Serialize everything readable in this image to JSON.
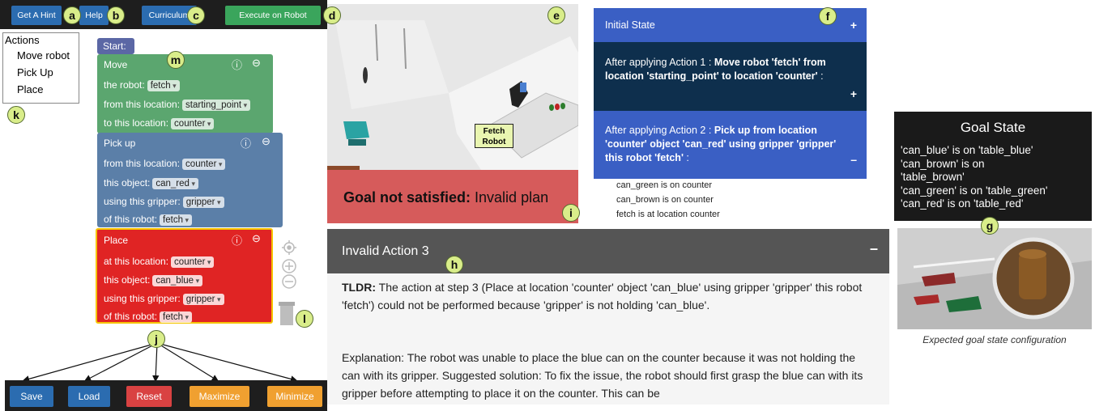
{
  "toolbar": {
    "hint": "Get A Hint",
    "help": "Help",
    "curriculum": "Curriculum",
    "execute": "Execute on Robot"
  },
  "actions_menu": {
    "header": "Actions",
    "items": [
      "Move robot",
      "Pick Up",
      "Place"
    ]
  },
  "program": {
    "start": "Start:",
    "move": {
      "title": "Move",
      "robot_label": "the robot:",
      "robot": "fetch",
      "from_label": "from this location:",
      "from": "starting_point",
      "to_label": "to this location:",
      "to": "counter"
    },
    "pickup": {
      "title": "Pick up",
      "loc_label": "from this location:",
      "loc": "counter",
      "obj_label": "this object:",
      "obj": "can_red",
      "grip_label": "using this gripper:",
      "grip": "gripper",
      "robot_label": "of this robot:",
      "robot": "fetch"
    },
    "place": {
      "title": "Place",
      "loc_label": "at this location:",
      "loc": "counter",
      "obj_label": "this object:",
      "obj": "can_blue",
      "grip_label": "using this gripper:",
      "grip": "gripper",
      "robot_label": "of this robot:",
      "robot": "fetch"
    },
    "info_icon": "ⓘ",
    "collapse_icon": "⊖"
  },
  "bottom": {
    "save": "Save",
    "load": "Load",
    "reset": "Reset",
    "maximize": "Maximize",
    "minimize": "Minimize"
  },
  "sim": {
    "robot_label_1": "Fetch",
    "robot_label_2": "Robot",
    "status_bold": "Goal not satisfied:",
    "status_rest": " Invalid plan"
  },
  "state": {
    "initial": "Initial State",
    "a1_prefix": "After applying Action 1 : ",
    "a1_bold": "Move robot 'fetch' from location 'starting_point' to location 'counter'",
    "a1_suffix": " :",
    "a2_prefix": "After applying Action 2 : ",
    "a2_bold": "Pick up from location 'counter' object 'can_red' using gripper 'gripper' this robot 'fetch'",
    "a2_suffix": " :",
    "facts": [
      "can_green is on counter",
      "can_brown is on counter",
      "fetch is at location counter"
    ],
    "plus": "+",
    "minus": "–"
  },
  "goal": {
    "title": "Goal State",
    "lines": [
      "'can_blue' is on 'table_blue'",
      "'can_brown' is on",
      "'table_brown'",
      "'can_green' is on 'table_green'",
      "'can_red' is on 'table_red'"
    ],
    "caption": "Expected goal state configuration"
  },
  "invalid": {
    "title": "Invalid Action 3",
    "minus": "–",
    "tldr_label": "TLDR:",
    "tldr": " The action at step 3 (Place at location 'counter' object 'can_blue' using gripper 'gripper' this robot 'fetch') could not be performed because 'gripper' is not holding 'can_blue'.",
    "explanation": "Explanation: The robot was unable to place the blue can on the counter because it was not holding the can with its gripper. Suggested solution: To fix the issue, the robot should first grasp the blue can with its gripper before attempting to place it on the counter. This can be"
  },
  "badges": {
    "a": "a",
    "b": "b",
    "c": "c",
    "d": "d",
    "e": "e",
    "f": "f",
    "g": "g",
    "h": "h",
    "i": "i",
    "j": "j",
    "k": "k",
    "l": "l",
    "m": "m"
  }
}
